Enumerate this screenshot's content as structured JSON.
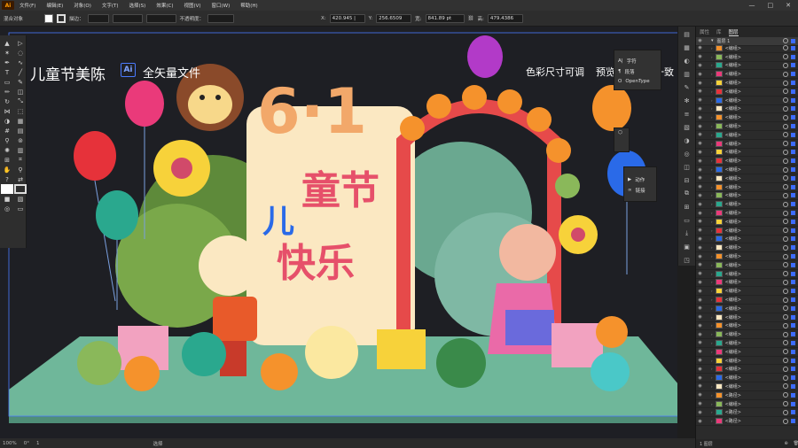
{
  "menubar": {
    "app_logo": "Ai",
    "items": [
      "文件(F)",
      "编辑(E)",
      "对象(O)",
      "文字(T)",
      "选择(S)",
      "效果(C)",
      "视图(V)",
      "窗口(W)",
      "帮助(H)"
    ],
    "window_controls": [
      "—",
      "□",
      "✕"
    ]
  },
  "controlbar": {
    "selection_label": "混合对象",
    "stroke_label": "描边：",
    "opacity_label": "不透明度：",
    "x_label": "X:",
    "x_value": "420.945 |",
    "y_label": "Y:",
    "y_value": "256.6509",
    "w_label": "宽:",
    "w_value": "841.89 pt",
    "h_label": "高:",
    "h_value": "479.4386"
  },
  "artwork": {
    "title": "儿童节美陈",
    "badge": "Ai",
    "subtitle": "全矢量文件",
    "right_text_1": "色彩尺寸可调",
    "right_text_2": "预览图层文件一致",
    "main_text_1": "童节",
    "main_text_2": "儿",
    "main_text_3": "快乐",
    "main_numeral": "6·1"
  },
  "float_panel_1": {
    "items": [
      "字符",
      "段落",
      "OpenType"
    ]
  },
  "float_panel_2": {
    "items": [
      "动作",
      "链接"
    ]
  },
  "layers": {
    "tabs": [
      "属性",
      "库",
      "图层"
    ],
    "top_layer": "图层 1",
    "rows": [
      "<编组>",
      "<编组>",
      "<编组>",
      "<编组>",
      "<编组>",
      "<编组>",
      "<编组>",
      "<编组>",
      "<编组>",
      "<编组>",
      "<编组>",
      "<编组>",
      "<编组>",
      "<编组>",
      "<编组>",
      "<编组>",
      "<编组>",
      "<编组>",
      "<编组>",
      "<编组>",
      "<编组>",
      "<编组>",
      "<编组>",
      "<编组>",
      "<编组>",
      "<编组>",
      "<编组>",
      "<编组>",
      "<编组>",
      "<编组>",
      "<编组>",
      "<编组>",
      "<编组>",
      "<编组>",
      "<编组>",
      "<编组>",
      "<编组>",
      "<编组>",
      "<编组>",
      "<编组>",
      "<路径>",
      "<编组>",
      "<路径>",
      "<路径>"
    ],
    "footer_label": "1 图层"
  },
  "statusbar": {
    "zoom": "100%",
    "rotation": "0°",
    "artboard": "1",
    "tool": "选择"
  },
  "colors": {
    "canvas_bg": "#1e1f24",
    "accent_blue": "#4a7aff",
    "floor": "#7cc4a8",
    "flower_yellow": "#f7d23a",
    "arch_red": "#e64a4a"
  }
}
